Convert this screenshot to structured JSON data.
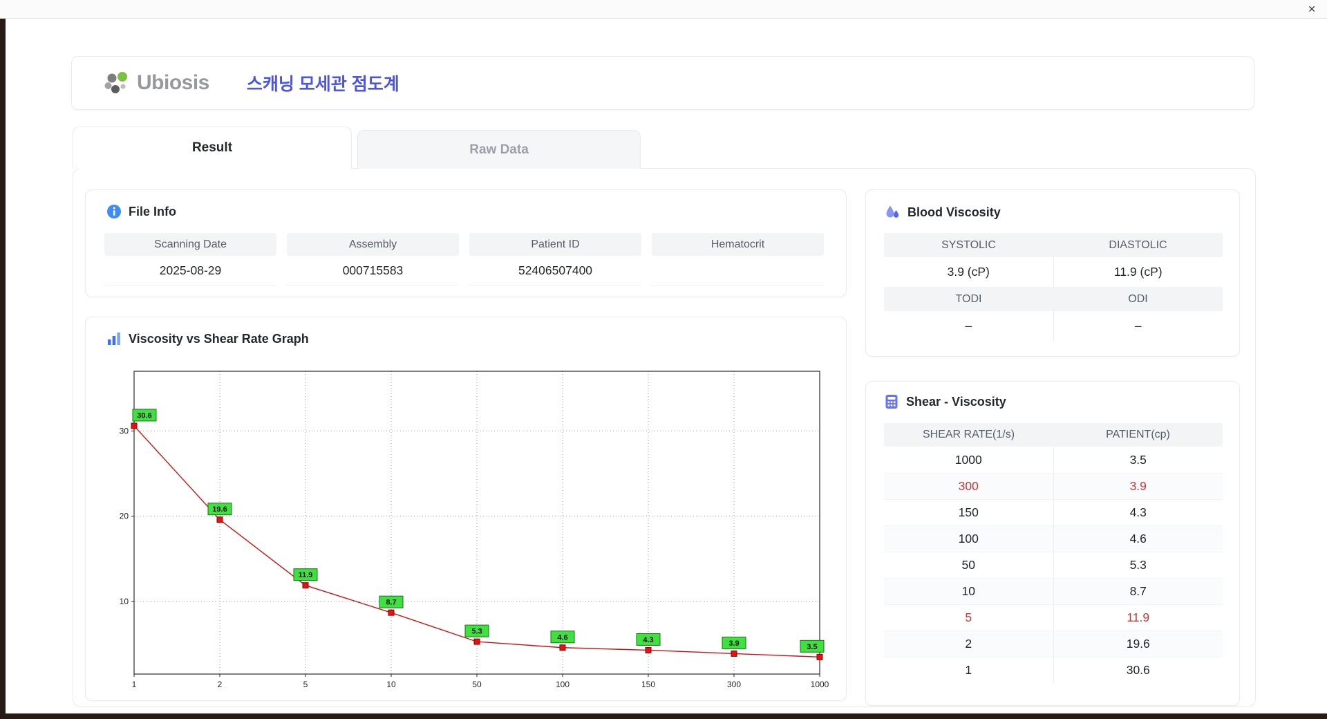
{
  "window": {
    "close_label": "✕"
  },
  "header": {
    "logo_text": "Ubiosis",
    "app_title": "스캐닝 모세관 점도계"
  },
  "tabs": {
    "result": "Result",
    "raw_data": "Raw Data"
  },
  "file_info": {
    "title": "File Info",
    "fields": [
      {
        "label": "Scanning Date",
        "value": "2025-08-29"
      },
      {
        "label": "Assembly",
        "value": "000715583"
      },
      {
        "label": "Patient ID",
        "value": "52406507400"
      },
      {
        "label": "Hematocrit",
        "value": ""
      }
    ]
  },
  "graph": {
    "title": "Viscosity vs Shear Rate Graph"
  },
  "blood_viscosity": {
    "title": "Blood Viscosity",
    "header1": [
      "SYSTOLIC",
      "DIASTOLIC"
    ],
    "values1": [
      "3.9 (cP)",
      "11.9 (cP)"
    ],
    "header2": [
      "TODI",
      "ODI"
    ],
    "values2": [
      "–",
      "–"
    ]
  },
  "shear_viscosity": {
    "title": "Shear - Viscosity",
    "columns": [
      "SHEAR RATE(1/s)",
      "PATIENT(cp)"
    ],
    "rows": [
      {
        "shear": "1000",
        "patient": "3.5",
        "highlight": false
      },
      {
        "shear": "300",
        "patient": "3.9",
        "highlight": true
      },
      {
        "shear": "150",
        "patient": "4.3",
        "highlight": false
      },
      {
        "shear": "100",
        "patient": "4.6",
        "highlight": false
      },
      {
        "shear": "50",
        "patient": "5.3",
        "highlight": false
      },
      {
        "shear": "10",
        "patient": "8.7",
        "highlight": false
      },
      {
        "shear": "5",
        "patient": "11.9",
        "highlight": true
      },
      {
        "shear": "2",
        "patient": "19.6",
        "highlight": false
      },
      {
        "shear": "1",
        "patient": "30.6",
        "highlight": false
      }
    ]
  },
  "chart_data": {
    "type": "line",
    "x": [
      1,
      2,
      5,
      10,
      50,
      100,
      150,
      300,
      1000
    ],
    "series": [
      {
        "name": "PATIENT",
        "values": [
          30.6,
          19.6,
          11.9,
          8.7,
          5.3,
          4.6,
          4.3,
          3.9,
          3.5
        ]
      }
    ],
    "title": "Viscosity vs Shear Rate Graph",
    "xlabel": "",
    "ylabel": "",
    "x_scale": "log-categorical-even-spacing",
    "yticks": [
      10,
      20,
      30
    ],
    "ylim": [
      1.5,
      37
    ],
    "grid": "dotted",
    "legend": "none",
    "line_color": "#cc1111",
    "marker_color": "#e01414",
    "marker_edge": "#8f0000",
    "point_label_bg": "#3fe03f",
    "point_label_border": "#117711"
  },
  "colors": {
    "accent_blue": "#4a55e6",
    "highlight_red": "#cf3434",
    "table_header_gray": "#f3f4f6"
  }
}
